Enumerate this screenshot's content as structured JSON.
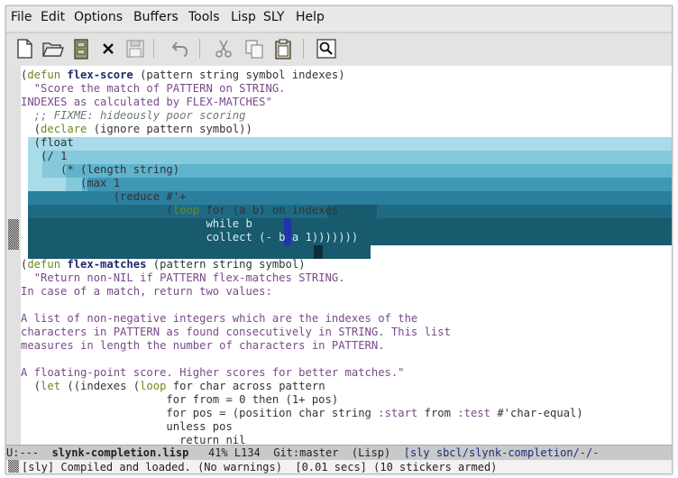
{
  "menubar": [
    "File",
    "Edit",
    "Options",
    "Buffers",
    "Tools",
    "Lisp",
    "SLY",
    "Help"
  ],
  "toolbar": [
    "new-file",
    "open-folder",
    "open-directory",
    "close-buffer",
    "save",
    "undo",
    "cut",
    "copy",
    "paste",
    "search"
  ],
  "code": {
    "l1_a": "(",
    "l1_b": "defun",
    "l1_c": " ",
    "l1_d": "flex-score",
    "l1_e": " (pattern string symbol indexes)",
    "l2": "  \"Score the match of PATTERN on STRING.",
    "l3": "INDEXES as calculated by FLEX-MATCHES\"",
    "l4": "  ;; FIXME: hideously poor scoring",
    "l5_a": "  (",
    "l5_b": "declare",
    "l5_c": " (ignore pattern symbol))",
    "l6": "  (float",
    "l7": "   (/ 1",
    "l8": "      (* (length string)",
    "l9": "         (max 1",
    "l10": "              (reduce #'+",
    "l11_a": "                      (",
    "l11_b": "loop",
    "l11_c": " for (a b) on indexes",
    "l12": "                            while b",
    "l13": "                            collect (- b a 1)))))))",
    "l15_a": "(",
    "l15_b": "defun",
    "l15_c": " ",
    "l15_d": "flex-matches",
    "l15_e": " (pattern string symbol)",
    "l16": "  \"Return non-NIL if PATTERN flex-matches STRING.",
    "l17": "In case of a match, return two values:",
    "l19": "A list of non-negative integers which are the indexes of the",
    "l20": "characters in PATTERN as found consecutively in STRING. This list",
    "l21": "measures in length the number of characters in PATTERN.",
    "l23": "A floating-point score. Higher scores for better matches.\"",
    "l24_a": "  (",
    "l24_b": "let",
    "l24_c": " ((indexes (",
    "l24_d": "loop",
    "l24_e": " for char across pattern",
    "l25": "                      for from = 0 then (1+ pos)",
    "l26_a": "                      for pos = (position char string ",
    "l26_b": ":start",
    "l26_c": " from ",
    "l26_d": ":test",
    "l26_e": " #'char-equal)",
    "l27": "                      unless pos",
    "l28": "                        return nil"
  },
  "modeline": {
    "status": "U:---  ",
    "buffer": "slynk-completion.lisp",
    "position": "   41% L134  Git:master  (Lisp)  ",
    "sly": "[sly sbcl/slynk-completion/-/-"
  },
  "echo": "[sly] Compiled and loaded. (No warnings)  [0.01 secs] (10 stickers armed)",
  "colors": {
    "band1": "#a9dbe8",
    "band2": "#86c8dc",
    "band3": "#5fb3cd",
    "band4": "#3f97b6",
    "band5": "#2b7f9e",
    "band6": "#1f6a82",
    "band7": "#185a6e"
  }
}
